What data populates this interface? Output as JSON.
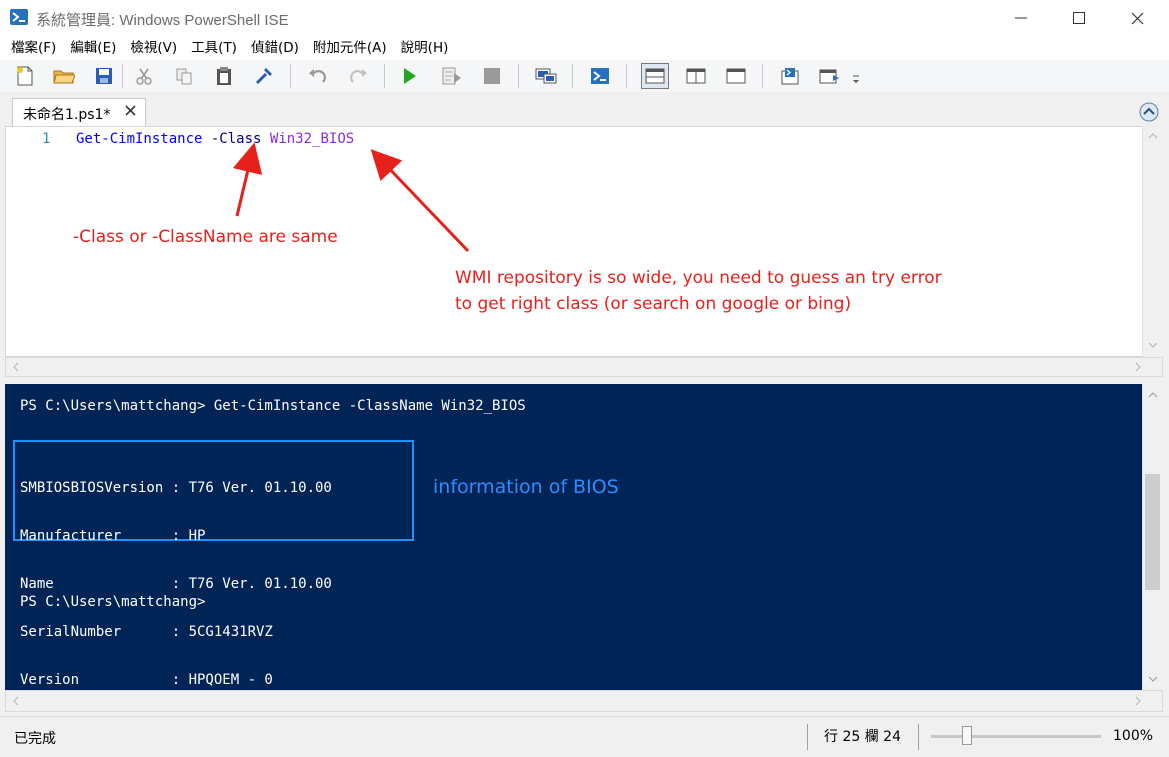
{
  "window": {
    "title": "系統管理員: Windows PowerShell ISE"
  },
  "menu": [
    "檔案(F)",
    "編輯(E)",
    "檢視(V)",
    "工具(T)",
    "偵錯(D)",
    "附加元件(A)",
    "說明(H)"
  ],
  "tab": {
    "label": "未命名1.ps1*"
  },
  "editor": {
    "line_number": "1",
    "code": {
      "command": "Get-CimInstance",
      "parameter": "-Class",
      "argument": "Win32_BIOS"
    }
  },
  "annotations": {
    "class_note": "-Class or -ClassName are same",
    "wmi_note_line1": "WMI repository is so wide, you need to guess an try error",
    "wmi_note_line2": "to get right class (or search on google or bing)",
    "bios_note": "information of BIOS",
    "arrow_color": "#e8201c"
  },
  "console": {
    "prompt_command": "PS C:\\Users\\mattchang> Get-CimInstance -ClassName Win32_BIOS",
    "bios_output": [
      "SMBIOSBIOSVersion : T76 Ver. 01.10.00",
      "Manufacturer      : HP",
      "Name              : T76 Ver. 01.10.00",
      "SerialNumber      : 5CG1431RVZ",
      "Version           : HPQOEM - 0"
    ],
    "prompt_empty": "PS C:\\Users\\mattchang>",
    "background_color": "#012456"
  },
  "status": {
    "state": "已完成",
    "position": "行 25  欄 24",
    "zoom": "100%"
  }
}
